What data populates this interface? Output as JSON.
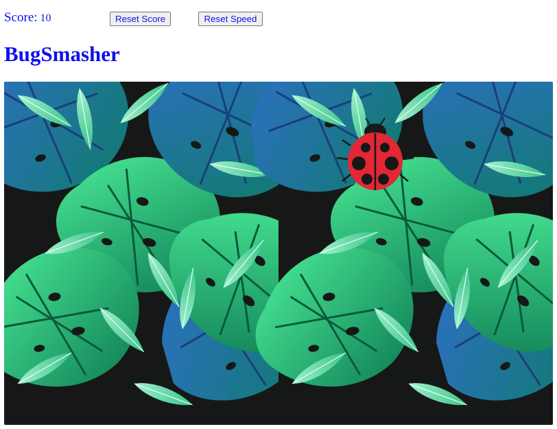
{
  "header": {
    "score_label": "Score:",
    "score_value": "10",
    "reset_score_label": "Reset Score",
    "reset_speed_label": "Reset Speed"
  },
  "title": "BugSmasher",
  "game": {
    "background": "tropical-monstera-leaves",
    "bug": "ladybug-icon"
  },
  "colors": {
    "text_accent": "#1010ee",
    "leaf_dark": "#0f8a5c",
    "leaf_light": "#3ee08a",
    "leaf_blue": "#2a55a8",
    "bg_dark": "#161818",
    "ladybug_red": "#e32735"
  }
}
